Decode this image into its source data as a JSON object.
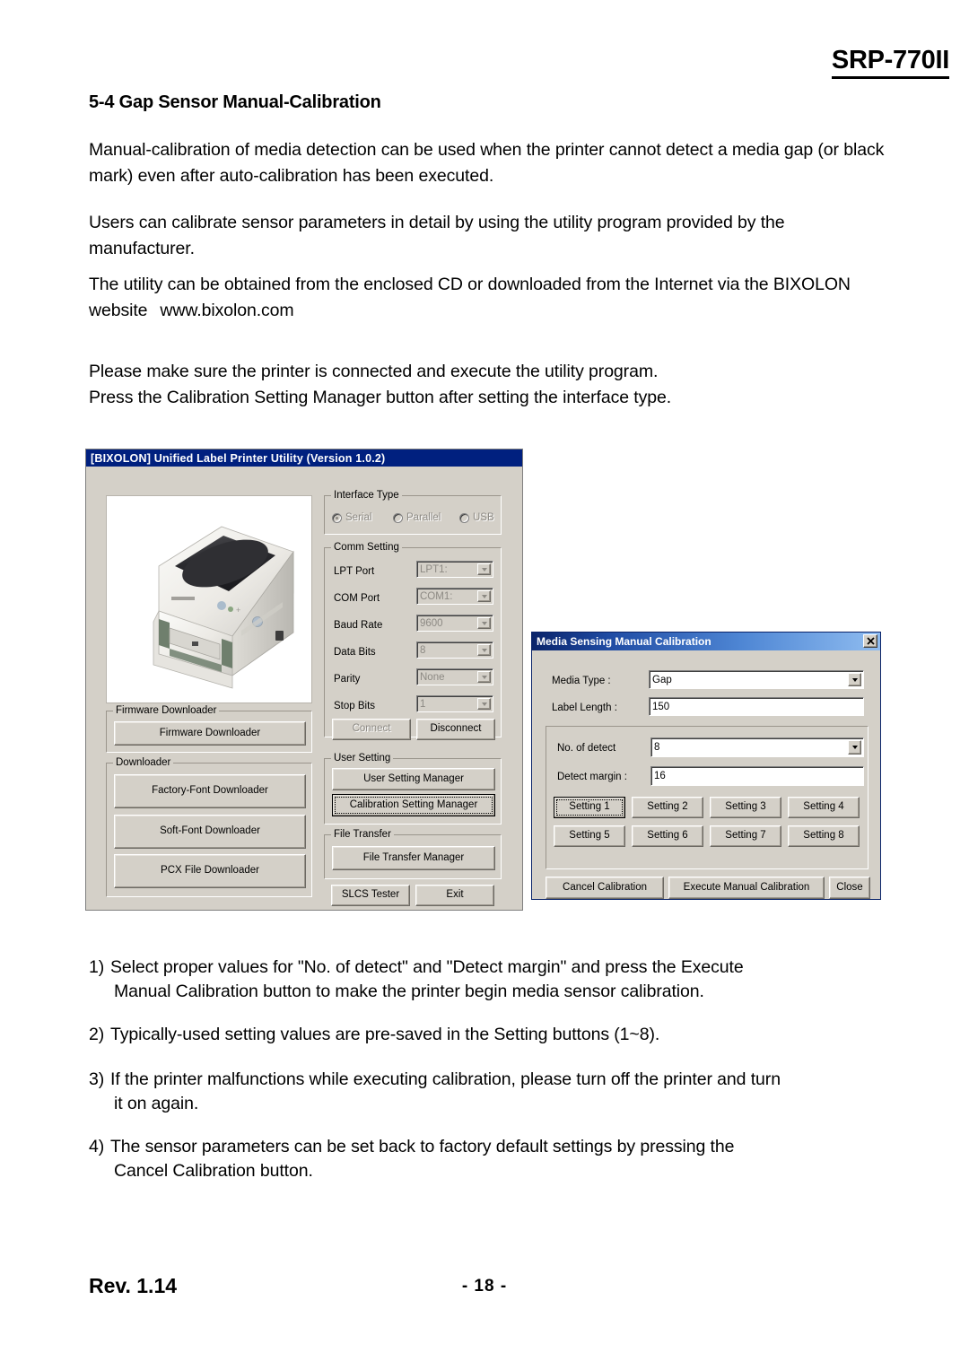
{
  "page": {
    "header_model": "SRP-770II",
    "section_heading": "5-4 Gap Sensor Manual-Calibration",
    "paragraphs": [
      "Manual-calibration of media detection can be used when the printer cannot detect a media gap (or black mark) even after auto-calibration has been executed.",
      "Users can calibrate sensor parameters in detail by using the utility program provided by the manufacturer.",
      "The utility can be obtained from the enclosed CD or downloaded from the Internet via the BIXOLON website",
      "www.bixolon.com",
      "Please make sure the printer is connected and execute the utility program.",
      "Press the Calibration Setting Manager button after setting the interface type."
    ],
    "notes": [
      {
        "num": "1)",
        "line1": "Select proper values for \"No. of detect\" and \"Detect margin\" and press the Execute",
        "line2": "Manual Calibration button to make the printer begin media sensor calibration."
      },
      {
        "num": "2)",
        "line1": "Typically-used setting values are pre-saved in the Setting buttons (1~8).",
        "line2": ""
      },
      {
        "num": "3)",
        "line1": "If the printer malfunctions while executing calibration, please turn off the printer and turn",
        "line2": "it on again."
      },
      {
        "num": "4)",
        "line1": "The sensor parameters can be set back to factory default settings by pressing the",
        "line2": "Cancel Calibration button."
      }
    ],
    "footer": {
      "revision": "Rev. 1.14",
      "page_number": "- 18 -"
    }
  },
  "utility_window": {
    "title": "[BIXOLON] Unified Label Printer Utility  (Version 1.0.2)",
    "printer_image_alt": "label-printer-photo",
    "interface_type": {
      "group_label": "Interface Type",
      "options": [
        "Serial",
        "Parallel",
        "USB"
      ],
      "selected": "Serial",
      "enabled": false
    },
    "comm_setting": {
      "group_label": "Comm Setting",
      "rows": [
        {
          "label": "LPT Port",
          "value": "LPT1:",
          "type": "combo"
        },
        {
          "label": "COM Port",
          "value": "COM1:",
          "type": "combo"
        },
        {
          "label": "Baud Rate",
          "value": "9600",
          "type": "combo"
        },
        {
          "label": "Data Bits",
          "value": "8",
          "type": "combo"
        },
        {
          "label": "Parity",
          "value": "None",
          "type": "combo"
        },
        {
          "label": "Stop Bits",
          "value": "1",
          "type": "combo"
        }
      ],
      "connect_label": "Connect",
      "disconnect_label": "Disconnect"
    },
    "firmware_downloader": {
      "group_label": "Firmware Downloader",
      "button_label": "Firmware Downloader"
    },
    "downloader": {
      "group_label": "Downloader",
      "buttons": [
        "Factory-Font Downloader",
        "Soft-Font Downloader",
        "PCX File Downloader"
      ]
    },
    "user_setting": {
      "group_label": "User Setting",
      "buttons": [
        "User Setting Manager",
        "Calibration Setting Manager"
      ],
      "focused_button": "Calibration Setting Manager"
    },
    "file_transfer": {
      "group_label": "File Transfer",
      "button_label": "File Transfer Manager"
    },
    "bottom_buttons": [
      "SLCS Tester",
      "Exit"
    ]
  },
  "calibration_dialog": {
    "title": "Media Sensing Manual Calibration",
    "close_label": "✕",
    "fields": [
      {
        "label": "Media Type :",
        "value": "Gap",
        "type": "combo"
      },
      {
        "label": "Label Length :",
        "value": "150",
        "type": "edit"
      },
      {
        "label": "No. of detect",
        "value": "8",
        "type": "combo"
      },
      {
        "label": "Detect margin :",
        "value": "16",
        "type": "edit"
      }
    ],
    "setting_buttons": [
      "Setting 1",
      "Setting 2",
      "Setting 3",
      "Setting 4",
      "Setting 5",
      "Setting 6",
      "Setting 7",
      "Setting 8"
    ],
    "focused_setting": "Setting 1",
    "action_buttons": [
      "Cancel Calibration",
      "Execute Manual Calibration",
      "Close"
    ]
  },
  "colors": {
    "dialog_face": "#d4d0c8",
    "main_title_bar": "#00207f",
    "dialog_title_bar_start": "#0a246a",
    "dialog_title_bar_end": "#8fbcf0",
    "field_bg": "#ffffff",
    "disabled_text": "#8d8a84"
  }
}
